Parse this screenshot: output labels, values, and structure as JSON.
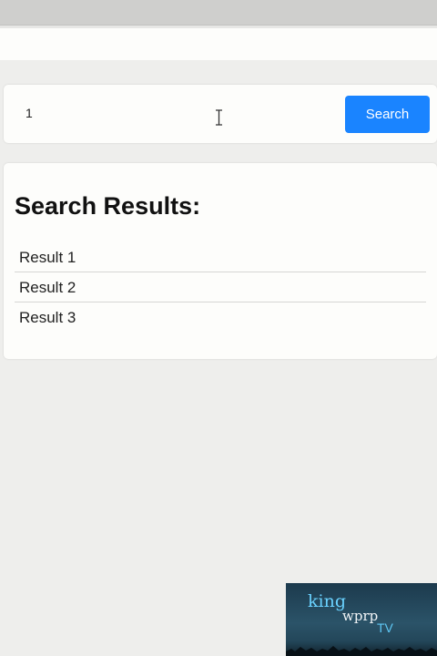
{
  "search": {
    "value": "1",
    "button_label": "Search"
  },
  "results": {
    "title": "Search Results:",
    "items": [
      "Result 1",
      "Result 2",
      "Result 3"
    ]
  },
  "watermark": {
    "line1": "king",
    "line2": "wprp",
    "line3": "TV"
  },
  "colors": {
    "accent": "#1a84ff",
    "page_background": "#eeeeec",
    "card_background": "#fdfdfb"
  }
}
